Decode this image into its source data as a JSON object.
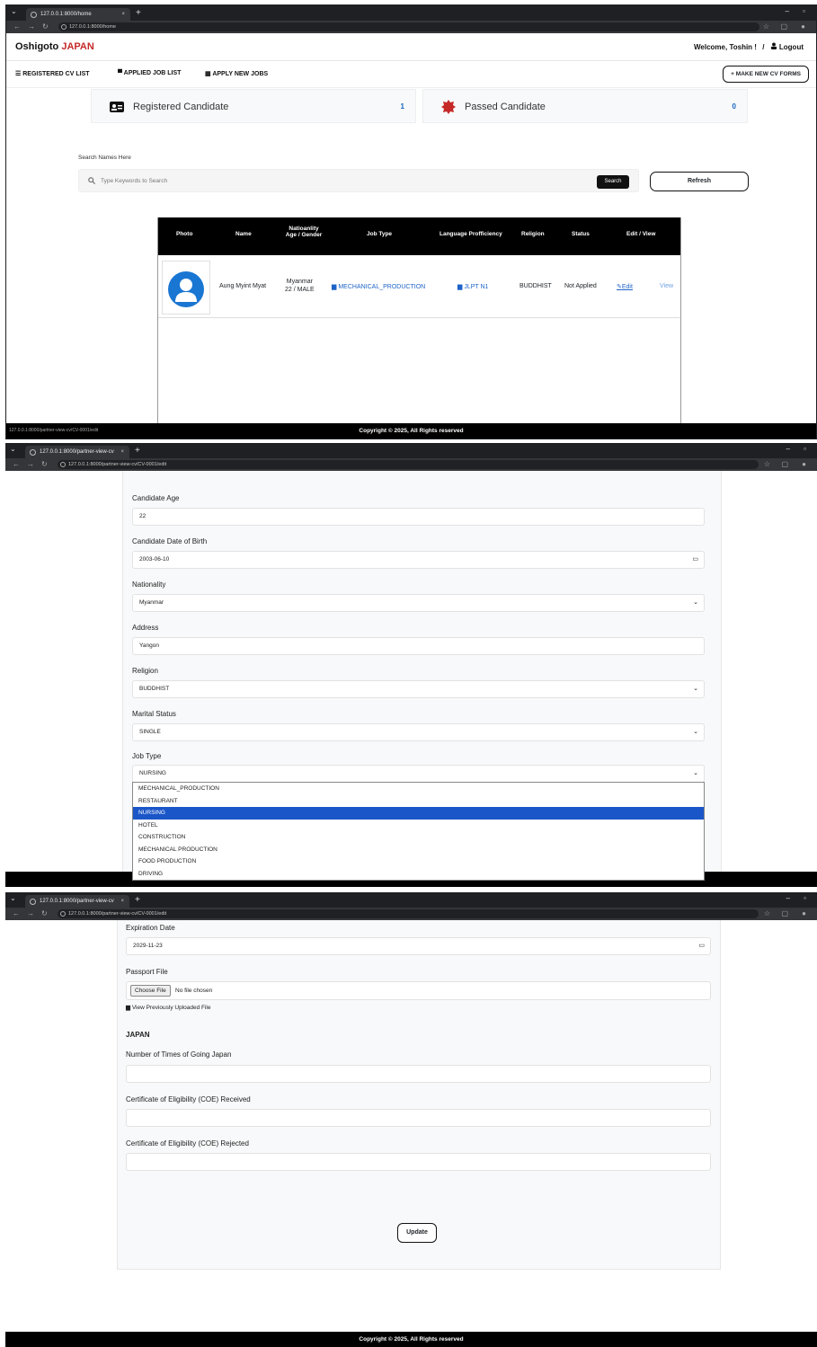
{
  "shot1": {
    "tab_title": "127.0.0.1:8000/home",
    "url": "127.0.0.1:8000/home",
    "brand_prefix": "Oshigoto",
    "brand_suffix": "JAPAN",
    "welcome": "Welcome, Toshin !",
    "separator": "/",
    "logout": "Logout",
    "nav": {
      "registered": "REGISTERED CV LIST",
      "applied": "APPLIED JOB LIST",
      "apply_new": "APPLY NEW JOBS",
      "make_new": "+ MAKE NEW CV FORMS"
    },
    "stats": {
      "registered_label": "Registered Candidate",
      "registered_count": "1",
      "passed_label": "Passed Candidate",
      "passed_count": "0"
    },
    "search": {
      "label": "Search Names Here",
      "placeholder": "Type Keywords to Search",
      "button": "Search",
      "refresh": "Refresh"
    },
    "table": {
      "headers": {
        "photo": "Photo",
        "name": "Name",
        "nationality_1": "Natioanlity",
        "nationality_2": "Age / Gender",
        "job_type": "Job Type",
        "language": "Language Profficiency",
        "religion": "Religion",
        "status": "Status",
        "edit_view": "Edit / View"
      },
      "row": {
        "name": "Aung Myint Myat",
        "nationality": "Myanmar",
        "age_gender": "22 / MALE",
        "job_type": "MECHANICAL_PRODUCTION",
        "language": "JLPT N1",
        "religion": "BUDDHIST",
        "status": "Not Applied",
        "edit": "Edit",
        "view": "View"
      }
    },
    "footer": "Copyright © 2025, All Rights reserved",
    "status_url": "127.0.0.1:8000/partner-view-cv/CV-0001/edit"
  },
  "shot2": {
    "tab_title": "127.0.0.1:8000/partner-view-cv",
    "url": "127.0.0.1:8000/partner-view-cv/CV-0001/edit",
    "fields": {
      "age_label": "Candidate Age",
      "age_value": "22",
      "dob_label": "Candidate Date of Birth",
      "dob_value": "2003-06-10",
      "nationality_label": "Nationality",
      "nationality_value": "Myanmar",
      "address_label": "Address",
      "address_value": "Yangon",
      "religion_label": "Religion",
      "religion_value": "BUDDHIST",
      "marital_label": "Marital Status",
      "marital_value": "SINGLE",
      "jobtype_label": "Job Type",
      "jobtype_value": "NURSING"
    },
    "job_options": [
      "MECHANICAL_PRODUCTION",
      "RESTAURANT",
      "NURSING",
      "HOTEL",
      "CONSTRUCTION",
      "MECHANICAL PRODUCTION",
      "FOOD PRODUCTION",
      "DRIVING"
    ],
    "selected_option_index": 2
  },
  "shot3": {
    "tab_title": "127.0.0.1:8000/partner-view-cv",
    "url": "127.0.0.1:8000/partner-view-cv/CV-0001/edit",
    "fields": {
      "expiration_label": "Expiration Date",
      "expiration_value": "2029-11-23",
      "passport_label": "Passport File",
      "choose_file": "Choose File",
      "no_file": "No file chosen",
      "view_prev": "View Previously Uploaded File",
      "japan_heading": "JAPAN",
      "times_label": "Number of Times of Going Japan",
      "coe_received_label": "Certificate of Eligibility (COE) Received",
      "coe_rejected_label": "Certificate of Eligibility (COE) Rejected"
    },
    "update": "Update",
    "footer": "Copyright © 2025, All Rights reserved"
  }
}
